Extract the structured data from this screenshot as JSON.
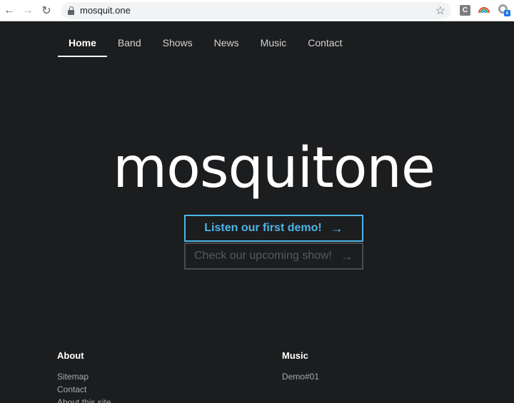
{
  "browser": {
    "url": "mosquit.one",
    "back_icon": "arrow-left-icon",
    "forward_icon": "arrow-right-icon",
    "reload_icon": "reload-icon",
    "ext_c_label": "C"
  },
  "nav": {
    "items": [
      {
        "label": "Home",
        "active": true
      },
      {
        "label": "Band"
      },
      {
        "label": "Shows"
      },
      {
        "label": "News"
      },
      {
        "label": "Music"
      },
      {
        "label": "Contact"
      }
    ]
  },
  "hero": {
    "title": "mosquitone",
    "primary_cta": "Listen our first demo!",
    "secondary_cta": "Check our upcoming show!",
    "accent_color": "#4cb5e8"
  },
  "footer": {
    "about": {
      "heading": "About",
      "links": [
        "Sitemap",
        "Contact",
        "About this site"
      ]
    },
    "music": {
      "heading": "Music",
      "links": [
        "Demo#01"
      ]
    }
  }
}
